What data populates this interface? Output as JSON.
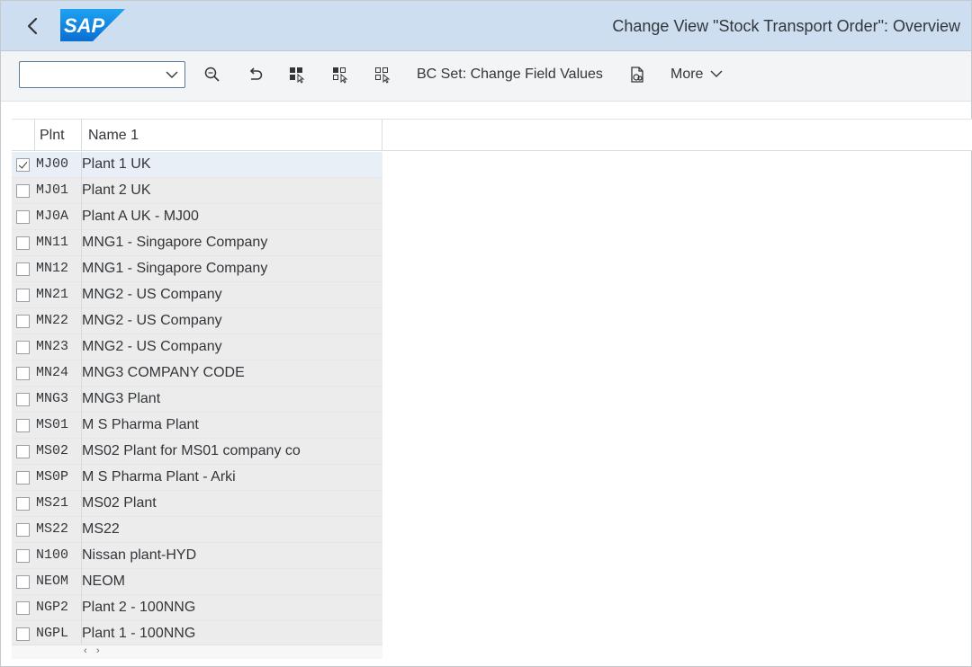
{
  "shell": {
    "brand": "SAP",
    "title": "Change View \"Stock Transport Order\": Overview",
    "back_icon": "chevron-left-icon",
    "brand_color": "#0a6ed1"
  },
  "toolbar": {
    "command_field_value": "",
    "bc_set_label": "BC Set: Change Field Values",
    "more_label": "More",
    "icons": [
      "find-icon",
      "undo-icon",
      "select-all-icon",
      "select-block-icon",
      "deselect-all-icon",
      "bc-set-icon"
    ]
  },
  "table": {
    "headers": {
      "plnt": "Plnt",
      "name": "Name 1"
    },
    "rows": [
      {
        "plnt": "MJ00",
        "name": "Plant 1 UK",
        "checked": true
      },
      {
        "plnt": "MJ01",
        "name": "Plant 2 UK",
        "checked": false
      },
      {
        "plnt": "MJ0A",
        "name": "Plant A UK - MJ00",
        "checked": false
      },
      {
        "plnt": "MN11",
        "name": "MNG1 - Singapore Company",
        "checked": false
      },
      {
        "plnt": "MN12",
        "name": "MNG1 - Singapore Company",
        "checked": false
      },
      {
        "plnt": "MN21",
        "name": "MNG2 -  US Company",
        "checked": false
      },
      {
        "plnt": "MN22",
        "name": "MNG2 -  US Company",
        "checked": false
      },
      {
        "plnt": "MN23",
        "name": "MNG2 -  US Company",
        "checked": false
      },
      {
        "plnt": "MN24",
        "name": "MNG3  COMPANY CODE",
        "checked": false
      },
      {
        "plnt": "MNG3",
        "name": "MNG3 Plant",
        "checked": false
      },
      {
        "plnt": "MS01",
        "name": "M S Pharma Plant",
        "checked": false
      },
      {
        "plnt": "MS02",
        "name": "MS02 Plant for MS01 company co",
        "checked": false
      },
      {
        "plnt": "MS0P",
        "name": "M S Pharma Plant - Arki",
        "checked": false
      },
      {
        "plnt": "MS21",
        "name": "MS02 Plant",
        "checked": false
      },
      {
        "plnt": "MS22",
        "name": "MS22",
        "checked": false
      },
      {
        "plnt": "N100",
        "name": "Nissan plant-HYD",
        "checked": false
      },
      {
        "plnt": "NEOM",
        "name": "NEOM",
        "checked": false
      },
      {
        "plnt": "NGP2",
        "name": "Plant 2 - 100NNG",
        "checked": false
      },
      {
        "plnt": "NGPL",
        "name": "Plant 1 - 100NNG",
        "checked": false
      }
    ]
  }
}
